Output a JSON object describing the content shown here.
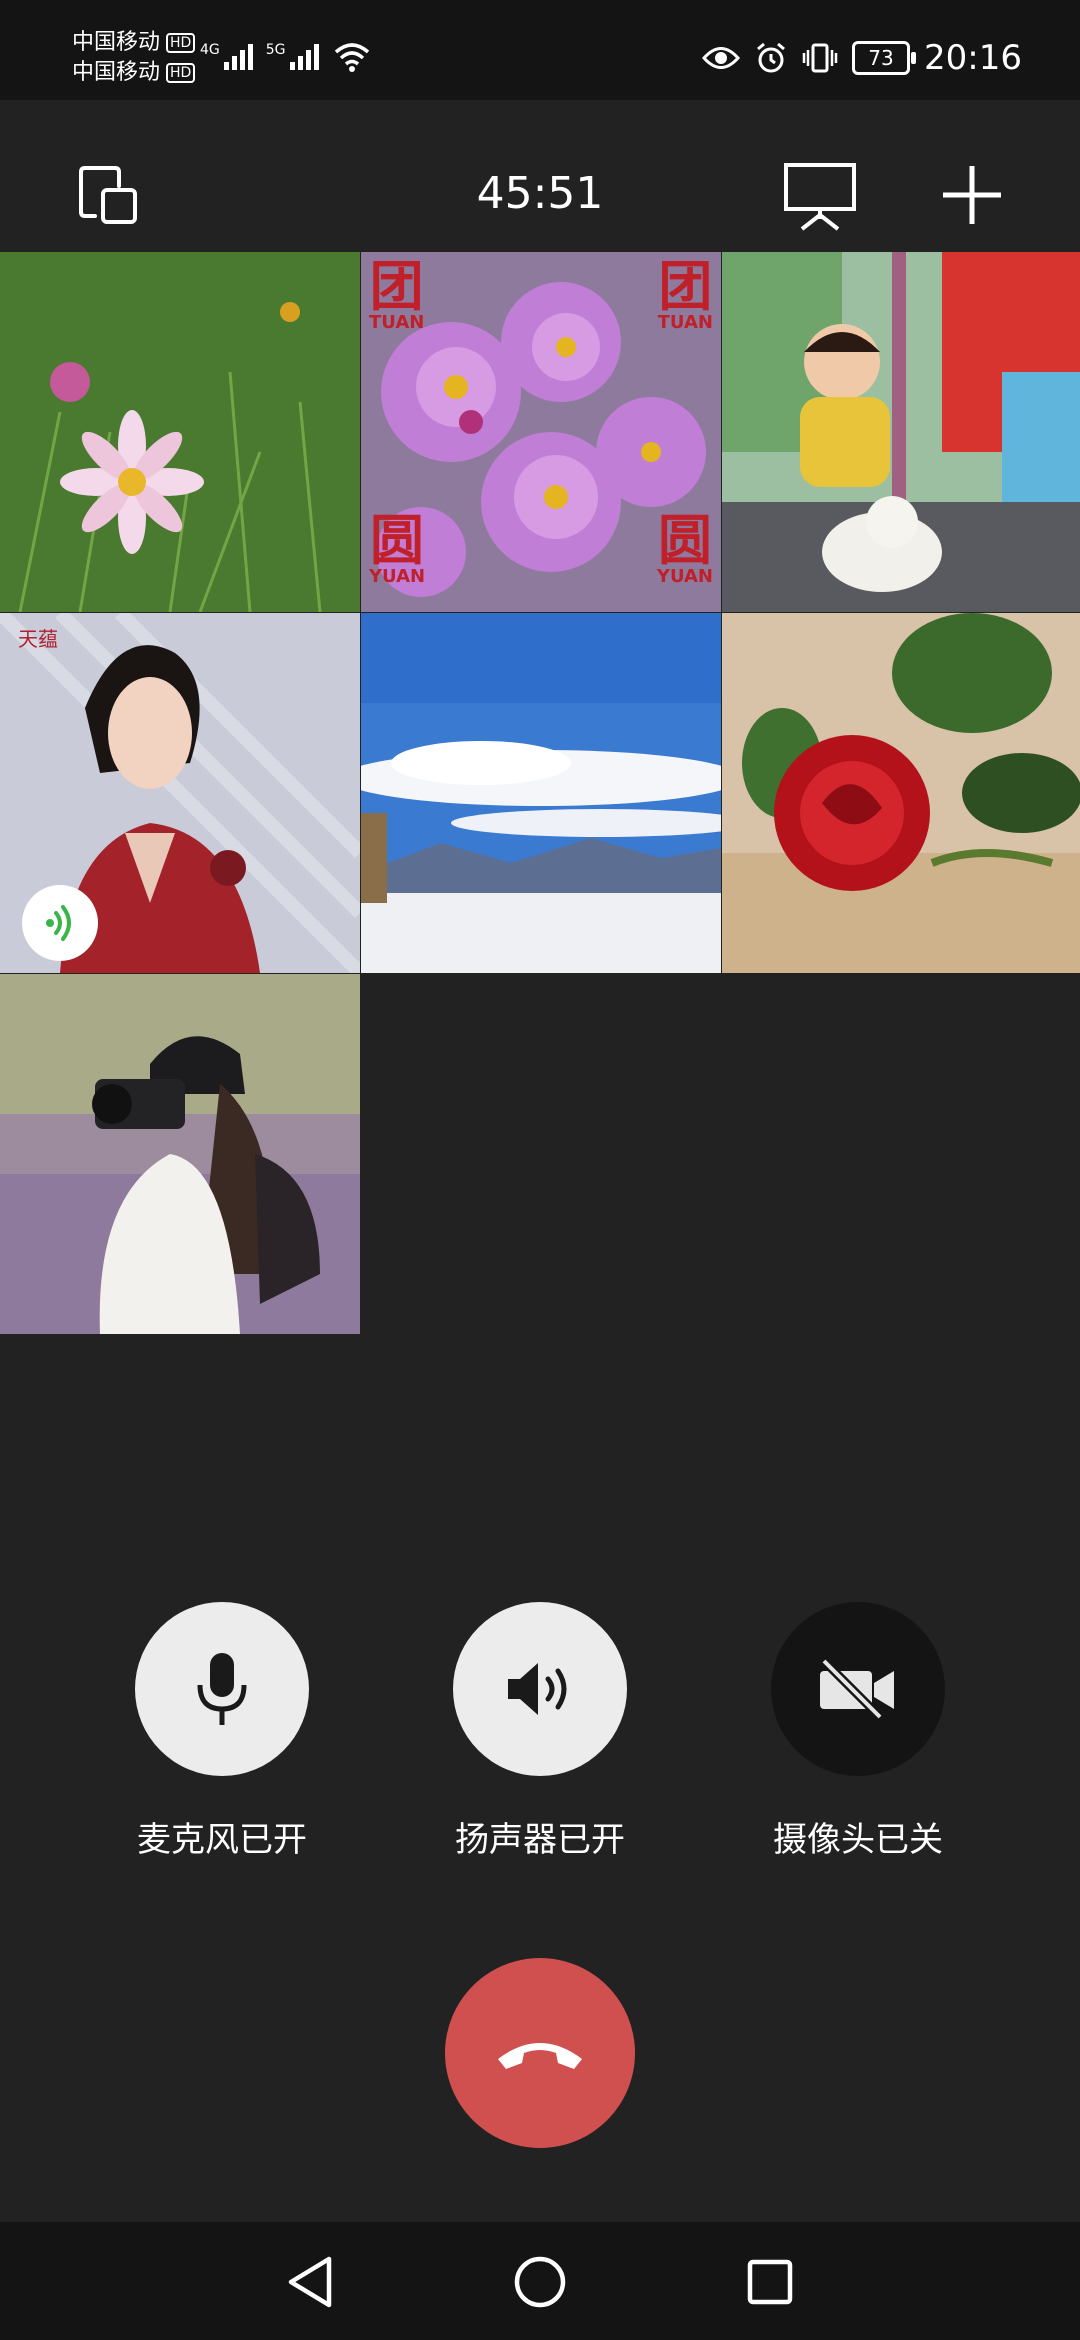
{
  "status_bar": {
    "carrier1": "中国移动",
    "carrier2": "中国移动",
    "hd": "HD",
    "net1": "4G",
    "net2": "5G",
    "battery": "73",
    "time": "20:16"
  },
  "call": {
    "timer": "45:51"
  },
  "tiles": [
    {
      "watermark_top": "团",
      "watermark_top_sub": "TUAN",
      "watermark_bottom": "圆",
      "watermark_bottom_sub": "YUAN"
    },
    {
      "badge": "天蕴"
    }
  ],
  "controls": {
    "mic_label": "麦克风已开",
    "speaker_label": "扬声器已开",
    "camera_label": "摄像头已关"
  },
  "icons": [
    "switch-screen-icon",
    "screen-share-icon",
    "add-icon",
    "microphone-icon",
    "speaker-icon",
    "camera-off-icon",
    "hangup-icon",
    "back-icon",
    "home-icon",
    "recents-icon",
    "speaking-indicator-icon"
  ],
  "colors": {
    "background": "#222223",
    "control_light": "#ececec",
    "control_dark": "#141414",
    "hangup": "#d05050"
  }
}
